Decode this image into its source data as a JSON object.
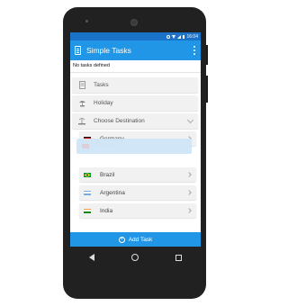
{
  "statusbar": {
    "time": "16:04"
  },
  "app": {
    "title": "Simple Tasks"
  },
  "main": {
    "empty_text": "No tasks defined"
  },
  "rows": [
    {
      "label": "Tasks",
      "icon": "clipboard-icon"
    },
    {
      "label": "Holiday",
      "icon": "beach-icon"
    },
    {
      "label": "Choose Destination",
      "icon": "island-icon"
    }
  ],
  "destinations": [
    {
      "label": "Germany",
      "flag": "germany-flag-icon",
      "colors": [
        "#000000",
        "#dd0000",
        "#ffce00"
      ]
    },
    {
      "label": "Brazil",
      "flag": "brazil-flag-icon",
      "colors": [
        "#009c3b",
        "#ffdf00",
        "#009c3b"
      ]
    },
    {
      "label": "Argentina",
      "flag": "argentina-flag-icon",
      "colors": [
        "#74acdf",
        "#ffffff",
        "#74acdf"
      ]
    },
    {
      "label": "India",
      "flag": "india-flag-icon",
      "colors": [
        "#ff9933",
        "#ffffff",
        "#138808"
      ]
    }
  ],
  "footer": {
    "add_label": "Add Task"
  },
  "colors": {
    "primary": "#2196e6",
    "statusbar": "#1a73c8",
    "drag": "#cfe6f8"
  }
}
